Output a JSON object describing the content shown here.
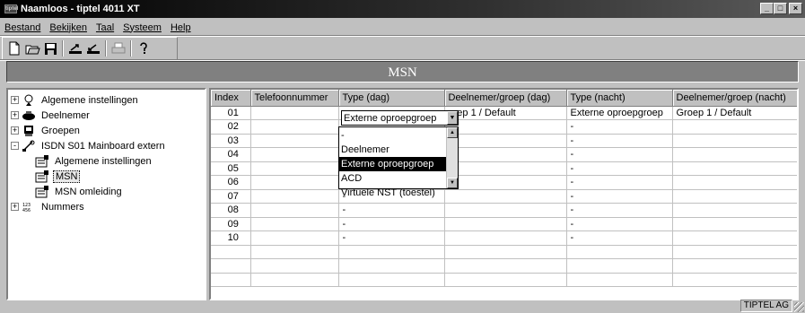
{
  "window": {
    "title": "Naamloos - tiptel 4011 XT",
    "app_icon_text": "tiptel",
    "minimize": "_",
    "maximize": "□",
    "close": "×"
  },
  "menu": [
    "Bestand",
    "Bekijken",
    "Taal",
    "Systeem",
    "Help"
  ],
  "toolbar": {
    "icons": [
      "new-file-icon",
      "open-folder-icon",
      "save-icon",
      "upload-icon",
      "download-icon",
      "print-icon",
      "help-icon"
    ]
  },
  "banner": {
    "title": "MSN"
  },
  "tree": {
    "nodes": [
      {
        "label": "Algemene instellingen",
        "expander": "+",
        "icon": "settings-icon",
        "level": 0
      },
      {
        "label": "Deelnemer",
        "expander": "+",
        "icon": "phone-icon",
        "level": 0
      },
      {
        "label": "Groepen",
        "expander": "+",
        "icon": "group-icon",
        "level": 0
      },
      {
        "label": "ISDN S01 Mainboard extern",
        "expander": "-",
        "icon": "isdn-icon",
        "level": 0
      },
      {
        "label": "Algemene instellingen",
        "expander": "",
        "icon": "property-sheet-icon",
        "level": 1
      },
      {
        "label": "MSN",
        "expander": "",
        "icon": "property-sheet-icon",
        "level": 1,
        "selected": true
      },
      {
        "label": "MSN omleiding",
        "expander": "",
        "icon": "property-sheet-icon",
        "level": 1
      },
      {
        "label": "Nummers",
        "expander": "+",
        "icon": "numbers-icon",
        "level": 0
      }
    ]
  },
  "grid": {
    "columns": [
      "Index",
      "Telefoonnummer",
      "Type (dag)",
      "Deelnemer/groep (dag)",
      "Type (nacht)",
      "Deelnemer/groep (nacht)"
    ],
    "rows": [
      [
        "01",
        "",
        "",
        "roep 1 / Default",
        "Externe oproepgroep",
        "Groep 1 / Default"
      ],
      [
        "02",
        "",
        "",
        "",
        "-",
        ""
      ],
      [
        "03",
        "",
        "",
        "",
        "-",
        ""
      ],
      [
        "04",
        "",
        "",
        "",
        "-",
        ""
      ],
      [
        "05",
        "",
        "",
        "",
        "-",
        ""
      ],
      [
        "06",
        "",
        "",
        "",
        "-",
        ""
      ],
      [
        "07",
        "",
        "-",
        "",
        "-",
        ""
      ],
      [
        "08",
        "",
        "-",
        "",
        "-",
        ""
      ],
      [
        "09",
        "",
        "-",
        "",
        "-",
        ""
      ],
      [
        "10",
        "",
        "-",
        "",
        "-",
        ""
      ],
      [
        "",
        "",
        "",
        "",
        "",
        ""
      ],
      [
        "",
        "",
        "",
        "",
        "",
        ""
      ],
      [
        "",
        "",
        "",
        "",
        "",
        ""
      ]
    ]
  },
  "combo": {
    "value": "Externe oproepgroep",
    "options": [
      "-",
      "Deelnemer",
      "Externe oproepgroep",
      "ACD",
      "Virtuele NST (toestel)"
    ],
    "selected": "Externe oproepgroep"
  },
  "status": {
    "company": "TIPTEL AG"
  }
}
